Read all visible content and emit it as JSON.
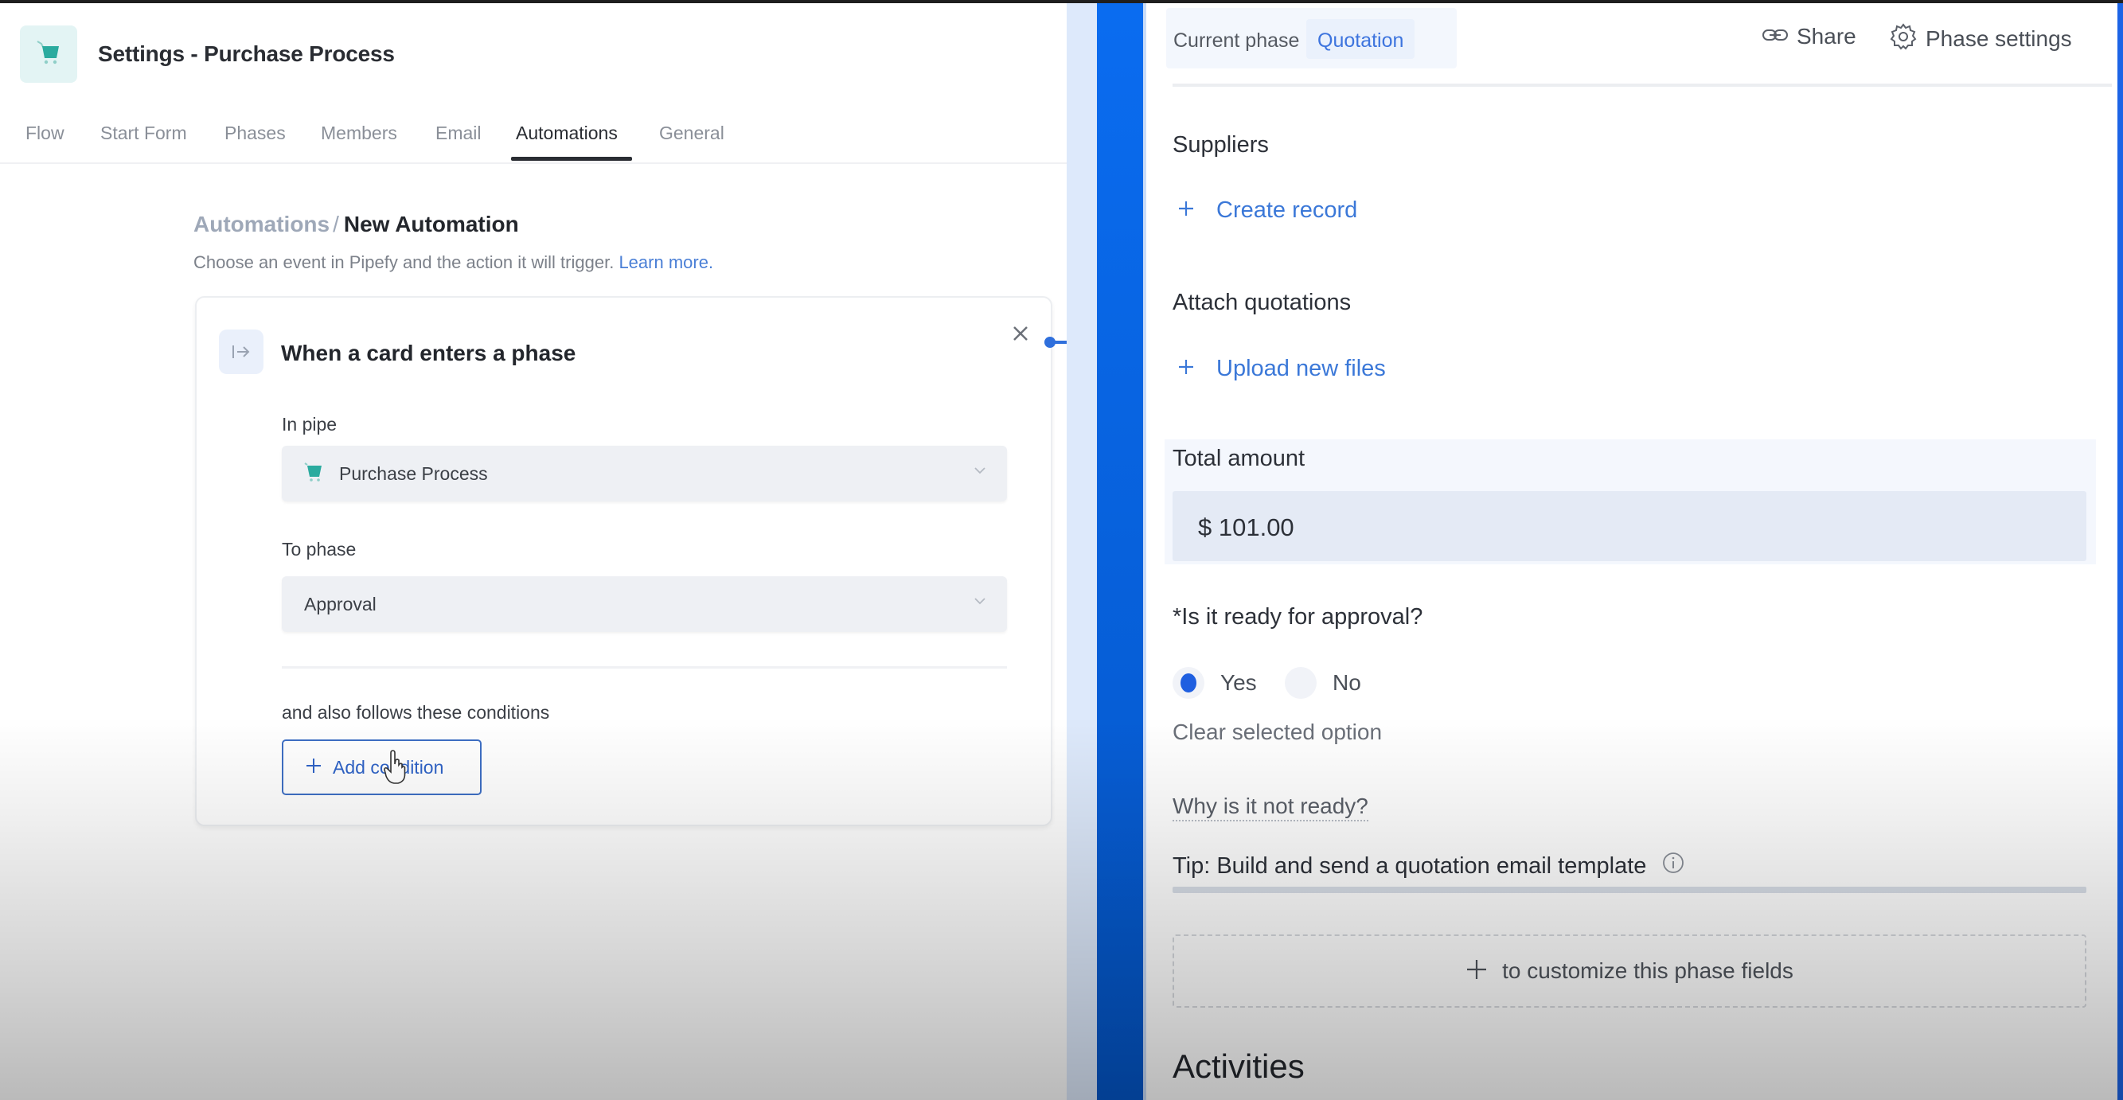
{
  "app": {
    "title": "Settings - Purchase Process",
    "brand_color": "#2bab9f"
  },
  "tabs": [
    {
      "label": "Flow",
      "active": false
    },
    {
      "label": "Start Form",
      "active": false
    },
    {
      "label": "Phases",
      "active": false
    },
    {
      "label": "Members",
      "active": false
    },
    {
      "label": "Email",
      "active": false
    },
    {
      "label": "Automations",
      "active": true
    },
    {
      "label": "General",
      "active": false
    }
  ],
  "breadcrumb": {
    "parent": "Automations",
    "separator": "/",
    "current": "New Automation"
  },
  "subtitle": {
    "text": "Choose an event in Pipefy and the action it will trigger.",
    "link": "Learn more."
  },
  "trigger_card": {
    "icon": "enter-arrow-icon",
    "title": "When a card enters a phase",
    "close_icon": "close-icon",
    "in_pipe": {
      "label": "In pipe",
      "value": "Purchase Process",
      "icon": "cart-icon"
    },
    "to_phase": {
      "label": "To phase",
      "value": "Approval"
    },
    "conditions_label": "and also follows these conditions",
    "add_condition_label": "Add condition"
  },
  "phase_panel": {
    "current_phase_label": "Current phase",
    "current_phase_value": "Quotation",
    "share_label": "Share",
    "phase_settings_label": "Phase settings",
    "fields": {
      "suppliers_label": "Suppliers",
      "create_record_label": "Create record",
      "attach_label": "Attach quotations",
      "upload_label": "Upload new files",
      "total_amount_label": "Total amount",
      "total_amount_value": "$ 101.00",
      "approval_question": "*Is it ready for approval?",
      "options": [
        {
          "label": "Yes",
          "selected": true
        },
        {
          "label": "No",
          "selected": false
        }
      ],
      "clear_option_label": "Clear selected option",
      "why_label": "Why is it not ready?",
      "tip_label": "Tip: Build and send a quotation email template"
    },
    "customize_label": "to customize this phase fields",
    "activities_label": "Activities"
  },
  "colors": {
    "accent_blue": "#0a6cf0",
    "link_blue": "#3b78d8",
    "selected_radio": "#1f5fe0"
  }
}
